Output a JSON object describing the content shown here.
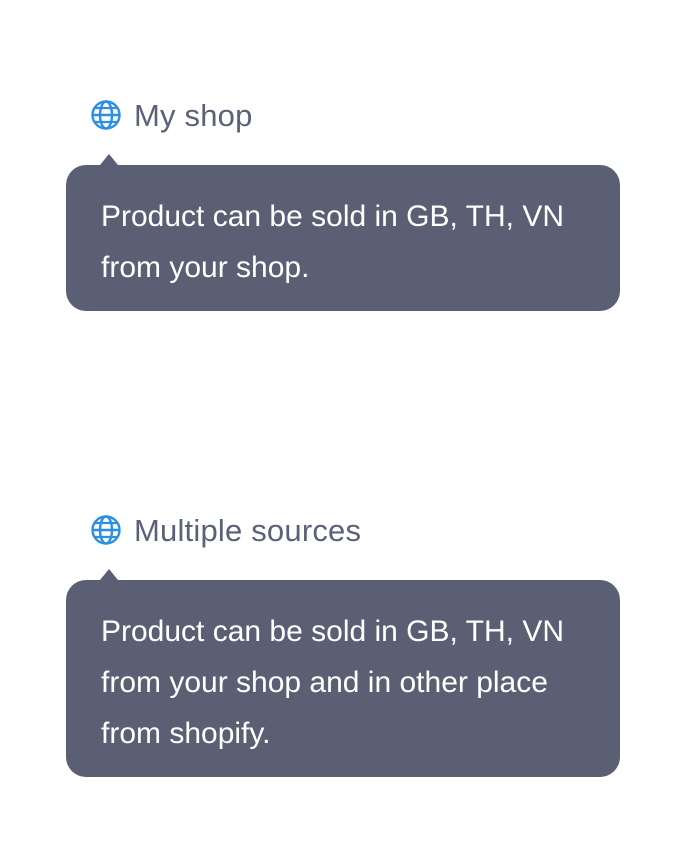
{
  "accent_color": "#2d8ee6",
  "tooltip_background": "#5a5f74",
  "label_color": "#5b6178",
  "items": [
    {
      "icon": "globe-icon",
      "label": "My shop",
      "tooltip_text": "Product can be sold in GB, TH, VN from your shop."
    },
    {
      "icon": "globe-icon",
      "label": "Multiple sources",
      "tooltip_text": "Product can be sold in GB, TH, VN from your shop and in other place from shopify."
    }
  ]
}
